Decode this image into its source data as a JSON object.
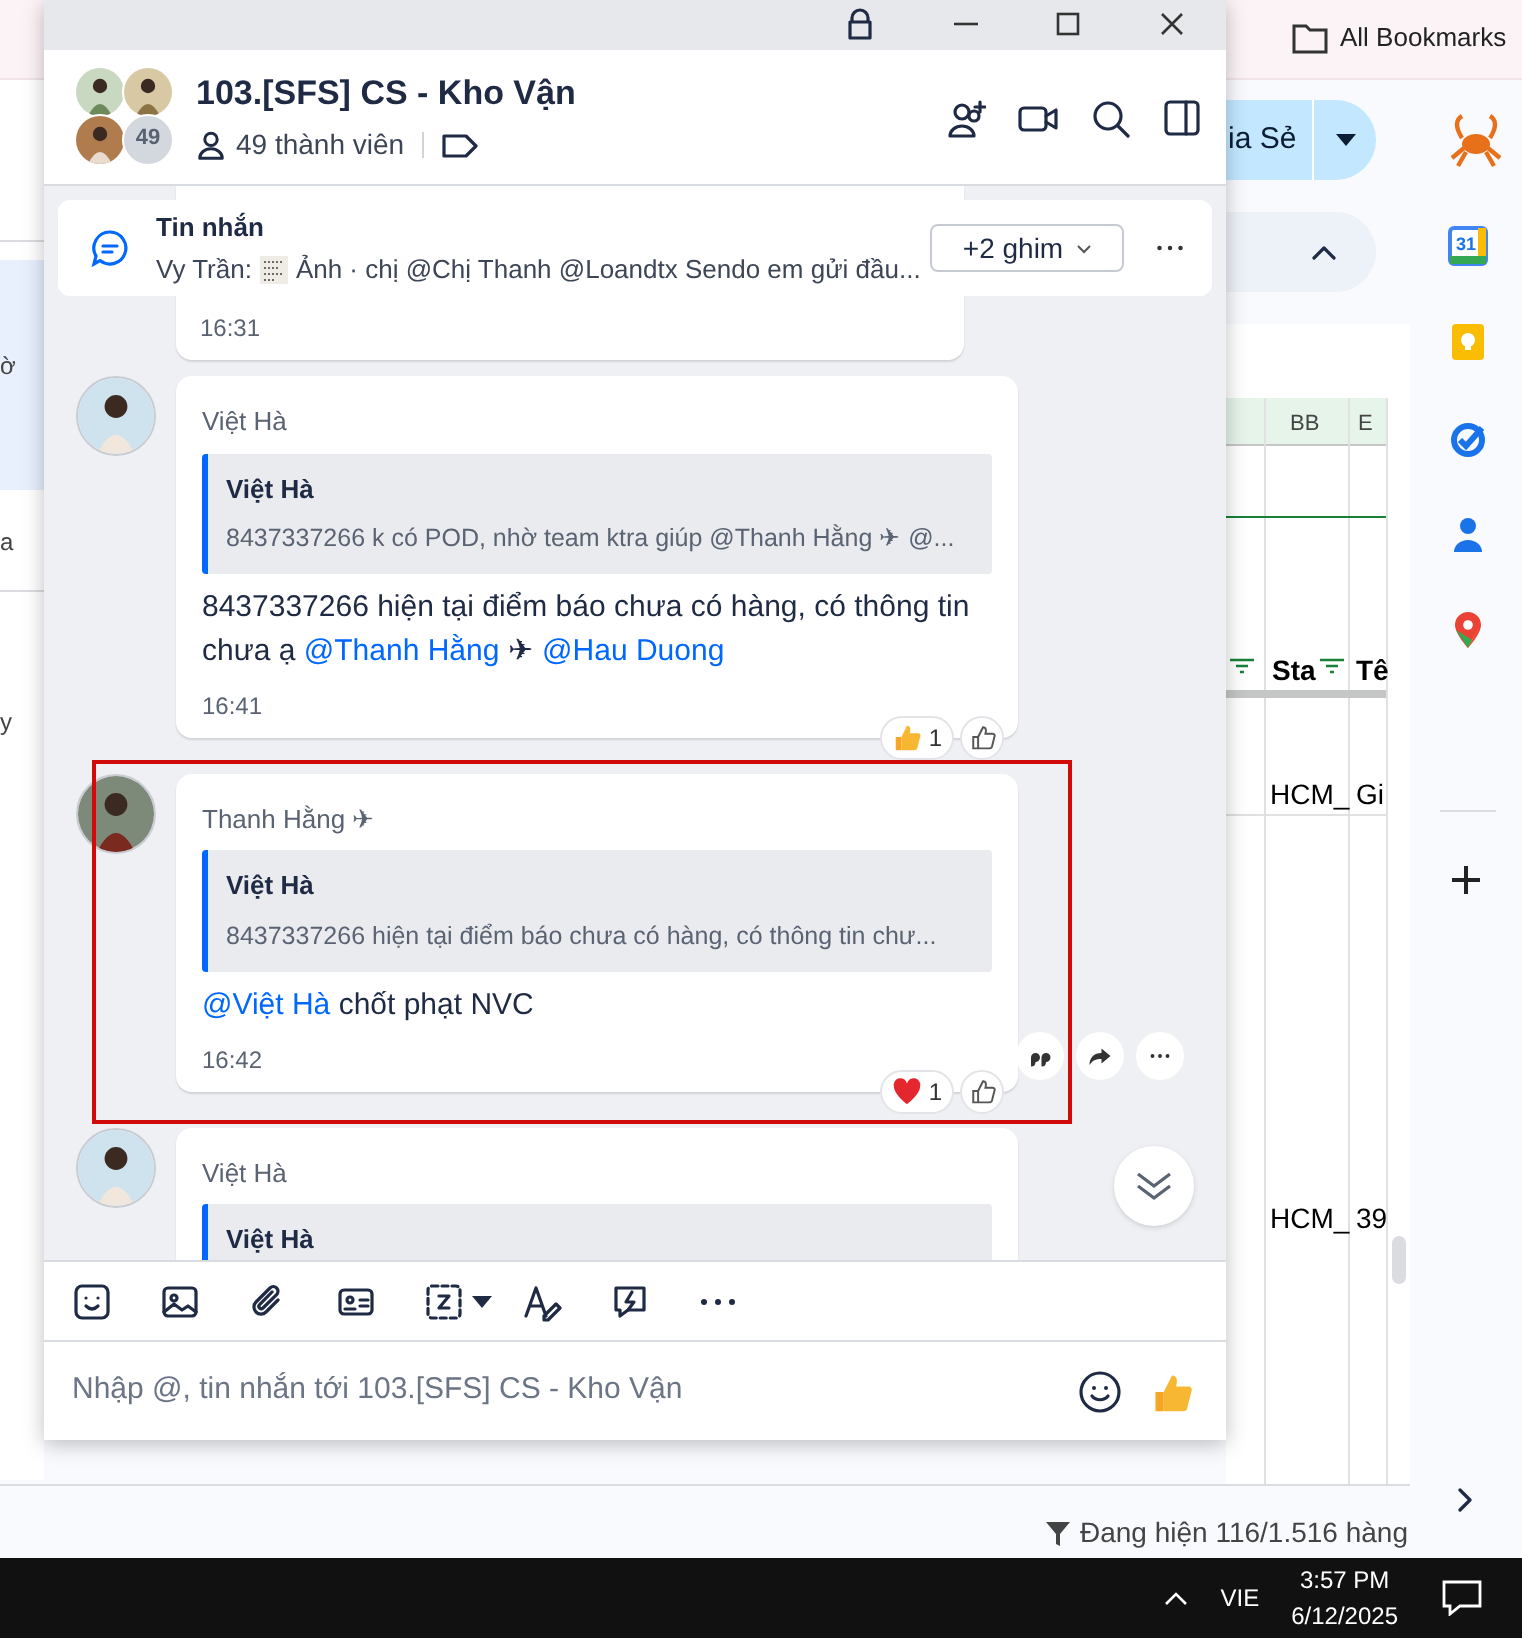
{
  "browser": {
    "bookmarks_label": "All Bookmarks",
    "share_button": "ia Sẻ",
    "left_fragments": [
      "ờ",
      "a",
      "y"
    ],
    "side_apps": [
      {
        "kind": "calendar",
        "label": "31"
      },
      {
        "kind": "keep"
      },
      {
        "kind": "tasks"
      },
      {
        "kind": "contacts"
      },
      {
        "kind": "maps"
      }
    ],
    "sheet": {
      "column_headers": [
        "BB",
        "E"
      ],
      "header_cells": [
        "Sta",
        "Tê"
      ],
      "rows": [
        [
          "HCM_",
          "Gi"
        ],
        [
          "HCM_",
          "39"
        ]
      ]
    },
    "status": "Đang hiện 116/1.516 hàng"
  },
  "chat_window": {
    "title": "103.[SFS] CS - Kho Vận",
    "member_count": "49",
    "members": "49 thành viên",
    "pinned": {
      "title": "Tin nhắn",
      "preview_sender": "Vy Trần:",
      "preview": "Ảnh · chị @Chị Thanh @Loandtx Sendo em gửi đầu...",
      "pins_button": "+2 ghim"
    },
    "messages": [
      {
        "kind": "tail",
        "time": "16:31"
      },
      {
        "kind": "message",
        "sender": "Việt Hà",
        "quote": {
          "author": "Việt Hà",
          "text": "8437337266 k có POD, nhờ team ktra giúp @Thanh Hằng ✈ @..."
        },
        "body": [
          {
            "kind": "text",
            "text": "8437337266 hiện tại điểm báo chưa có hàng, có thông tin chưa ạ "
          },
          {
            "kind": "mention",
            "text": "@Thanh Hằng"
          },
          {
            "kind": "text",
            "text": " ✈ "
          },
          {
            "kind": "mention",
            "text": "@Hau Duong"
          }
        ],
        "time": "16:41",
        "reactions": [
          {
            "kind": "like",
            "count": "1"
          }
        ],
        "highlighted": false,
        "hovered": false
      },
      {
        "kind": "message",
        "sender": "Thanh Hằng ✈",
        "quote": {
          "author": "Việt Hà",
          "text": "8437337266 hiện tại điểm báo chưa có hàng, có thông tin chư..."
        },
        "body": [
          {
            "kind": "mention",
            "text": "@Việt Hà"
          },
          {
            "kind": "text",
            "text": " chốt phạt NVC"
          }
        ],
        "time": "16:42",
        "reactions": [
          {
            "kind": "heart",
            "count": "1"
          }
        ],
        "highlighted": true,
        "hovered": true
      },
      {
        "kind": "message",
        "sender": "Việt Hà",
        "quote": {
          "author": "Việt Hà"
        },
        "highlighted": false,
        "hovered": false
      }
    ],
    "composer": {
      "placeholder": "Nhập @, tin nhắn tới 103.[SFS] CS - Kho Vận"
    }
  },
  "taskbar": {
    "language": "VIE",
    "time": "3:57 PM",
    "date": "6/12/2025"
  }
}
